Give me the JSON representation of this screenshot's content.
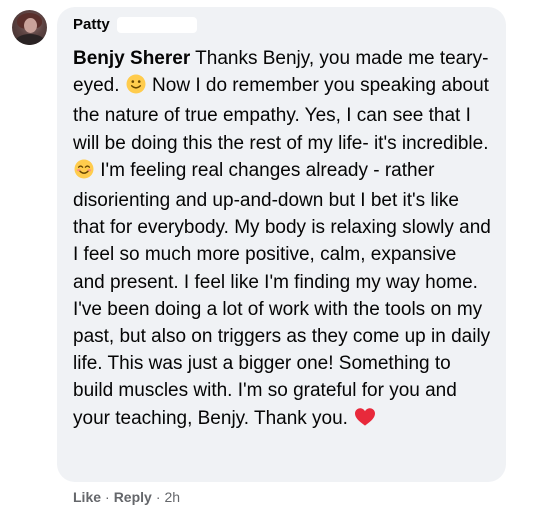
{
  "comment": {
    "author": "Patty",
    "mention": "Benjy Sherer",
    "segments": [
      " Thanks Benjy, you made me teary-eyed. ",
      " Now I do remember you speaking about the nature of true empathy. Yes, I can see that I will be doing this the rest of my life- it's incredible. ",
      " I'm feeling real changes already - rather disorienting and up-and-down but I bet it's like that for everybody. My body is relaxing slowly and I feel so much more positive, calm, expansive and present. I feel like I'm finding my way home. I've been doing a lot of work with the tools on my past, but also on triggers as they come up in daily life. This was just a bigger one! Something to build muscles with. I'm so grateful for you and your teaching, Benjy. Thank you. "
    ],
    "emoji_icons": [
      "slightly-smiling-face-icon",
      "smiling-face-with-smiling-eyes-icon",
      "red-heart-icon"
    ]
  },
  "actions": {
    "like_label": "Like",
    "separator": "·",
    "reply_label": "Reply",
    "timestamp": "2h"
  },
  "colors": {
    "bubble": "#f0f2f5",
    "text": "#050505",
    "meta": "#65676b",
    "emoji_yellow": "#ffcc4d",
    "heart_red": "#e8293b"
  }
}
